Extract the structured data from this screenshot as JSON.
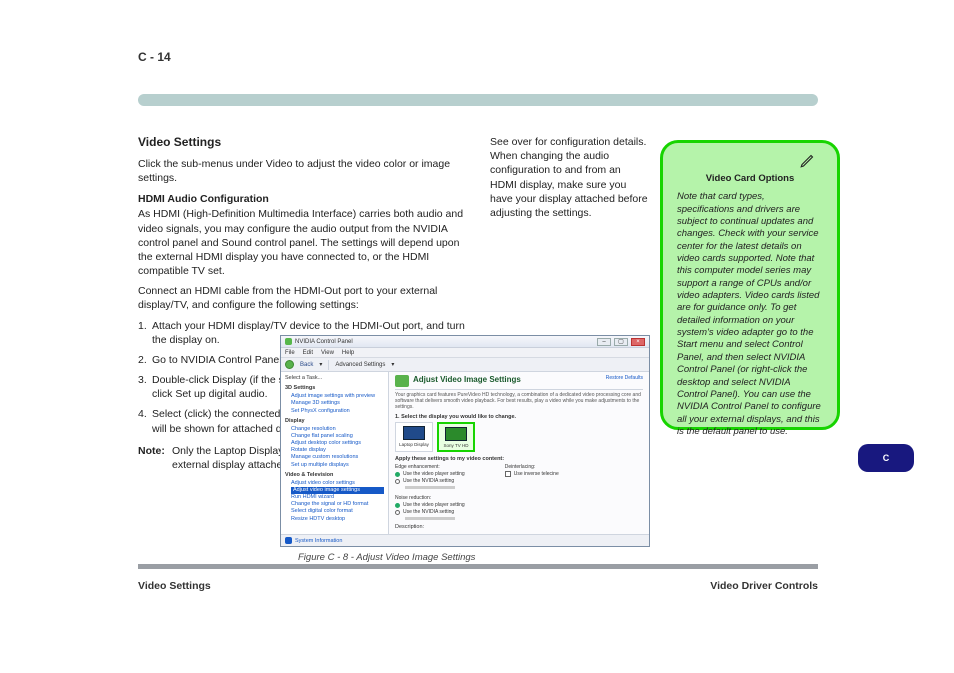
{
  "page_number": "C - 14",
  "left_column": {
    "section_title": "Video Settings",
    "intro": "Click the sub-menus under Video to adjust the video color or image settings.",
    "sub_heading": "HDMI Audio Configuration",
    "para1": "As HDMI (High-Definition Multimedia Interface) carries both audio and video signals, you may configure the audio output from the NVIDIA control panel and Sound control panel. The settings will depend upon the external HDMI display you have connected to, or the HDMI compatible TV set.",
    "para2": "Connect an HDMI cable from the HDMI-Out port to your external display/TV, and configure the following settings:",
    "steps": [
      "Attach your HDMI display/TV device to the HDMI-Out port, and turn the display on.",
      "Go to NVIDIA Control Panel.",
      "Double-click Display (if the sub-menus are not visible), and then click Set up digital audio.",
      "Select (click) the connected display icon at the top (display icons will be shown for attached displays and TVs etc.)."
    ],
    "note_label": "Note:",
    "note_text": "Only the Laptop Display will appear if you do not have an external display attached."
  },
  "right_column": {
    "para": "See over for configuration details. When changing the audio configuration to and from an HDMI display, make sure you have your display attached before adjusting the settings."
  },
  "note_box": {
    "title": "Video Card Options",
    "body": "Note that card types, specifications and drivers are subject to continual updates and changes. Check with your service center for the latest details on video cards supported. Note that this computer model series may support a range of CPUs and/or video adapters. Video cards listed are for guidance only. To get detailed information on your system's video adapter go to the Start menu and select Control Panel, and then select NVIDIA Control Panel (or right-click the desktop and select NVIDIA Control Panel). You can use the NVIDIA Control Panel to configure all your external displays, and this is the default panel to use."
  },
  "blue_pill": "C",
  "figure": {
    "window_title": "NVIDIA Control Panel",
    "menu": [
      "File",
      "Edit",
      "View",
      "Help"
    ],
    "back_label": "Back",
    "advanced": "Advanced Settings",
    "tree_header": "Select a Task...",
    "tree_groups": [
      {
        "label": "3D Settings",
        "items": [
          "Adjust image settings with preview",
          "Manage 3D settings",
          "Set PhysX configuration"
        ]
      },
      {
        "label": "Display",
        "items": [
          "Change resolution",
          "Change flat panel scaling",
          "Adjust desktop color settings",
          "Rotate display",
          "Manage custom resolutions",
          "Set up multiple displays"
        ]
      },
      {
        "label": "Video & Television",
        "items": [
          "Adjust video color settings",
          "Adjust video image settings",
          "Run HDMI wizard",
          "Change the signal or HD format",
          "Select digital color format",
          "Resize HDTV desktop"
        ]
      }
    ],
    "tree_selected": "Adjust video image settings",
    "main_title": "Adjust Video Image Settings",
    "restore": "Restore Defaults",
    "main_desc": "Your graphics card features PureVideo HD technology, a combination of a dedicated video processing core and software that delivers smooth video playback. For best results, play a video while you make adjustments to the settings.",
    "step1": "1. Select the display you would like to change.",
    "displays": [
      {
        "label": "Laptop Display",
        "selected": false
      },
      {
        "label": "Sony TV HD",
        "selected": true
      }
    ],
    "apply_label": "Apply these settings to my video content:",
    "edge_label": "Edge enhancement:",
    "deint_label": "Deinterlacing:",
    "opt_player": "Use the video player setting",
    "opt_nvidia": "Use the NVIDIA setting",
    "opt_inverse": "Use inverse telecine",
    "noise_label": "Noise reduction:",
    "desc_label": "Description:",
    "status": "System Information"
  },
  "figure_caption": "Figure C - 8 - Adjust Video Image Settings",
  "footer_left": "Video Settings",
  "footer_right": "Video Driver Controls"
}
